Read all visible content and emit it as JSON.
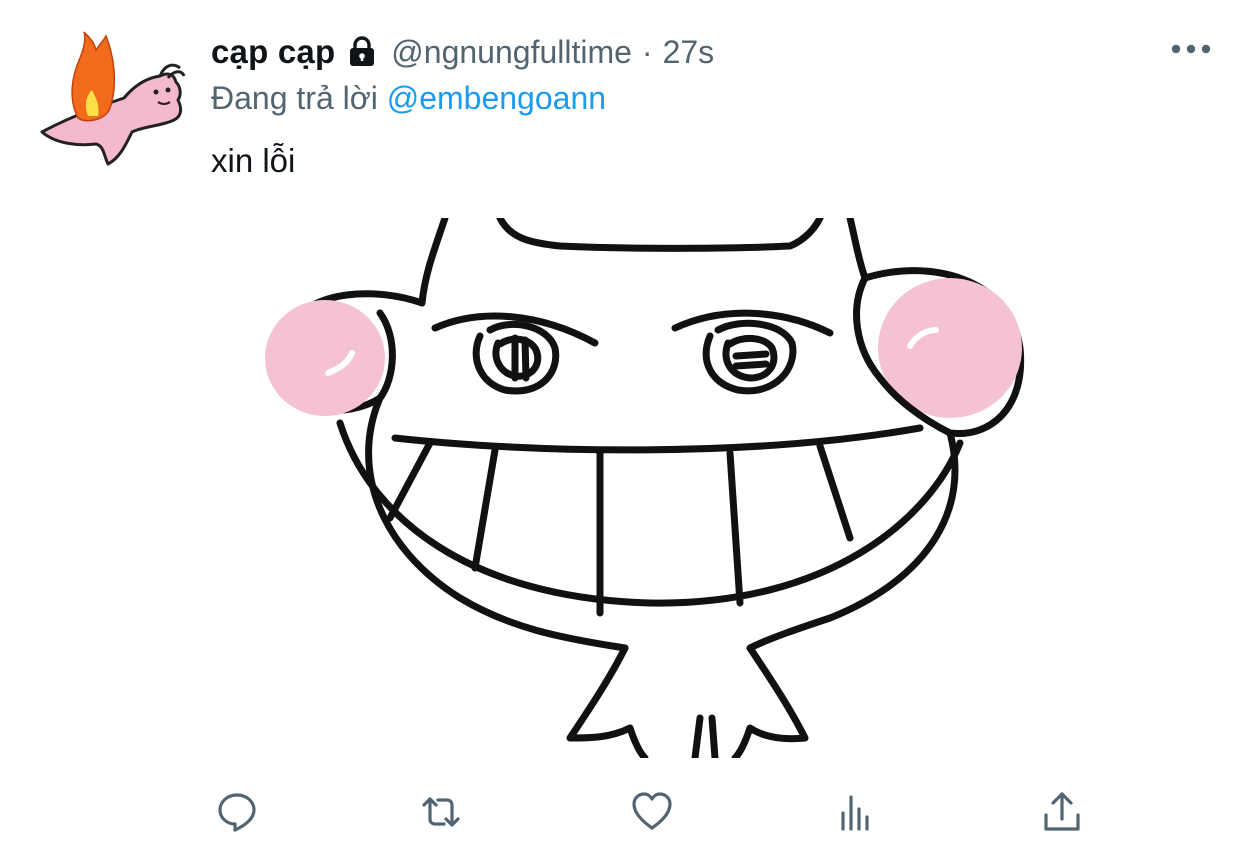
{
  "tweet": {
    "display_name": "cạp cạp",
    "handle": "@ngnungfulltime",
    "separator": "·",
    "timestamp": "27s",
    "reply_prefix": "Đang trả lời",
    "reply_to": "@embengoann",
    "text": "xin lỗi",
    "protected_icon": "lock-icon",
    "more_icon": "more-dots-icon"
  },
  "actions": [
    {
      "name": "reply",
      "icon": "reply-icon"
    },
    {
      "name": "retweet",
      "icon": "retweet-icon"
    },
    {
      "name": "like",
      "icon": "heart-icon"
    },
    {
      "name": "analytics",
      "icon": "analytics-icon"
    },
    {
      "name": "share",
      "icon": "share-icon"
    }
  ],
  "colors": {
    "text": "#0f1419",
    "secondary": "#536471",
    "link": "#1d9bf0",
    "icon": "#536471",
    "blush": "#f4c2d0"
  }
}
